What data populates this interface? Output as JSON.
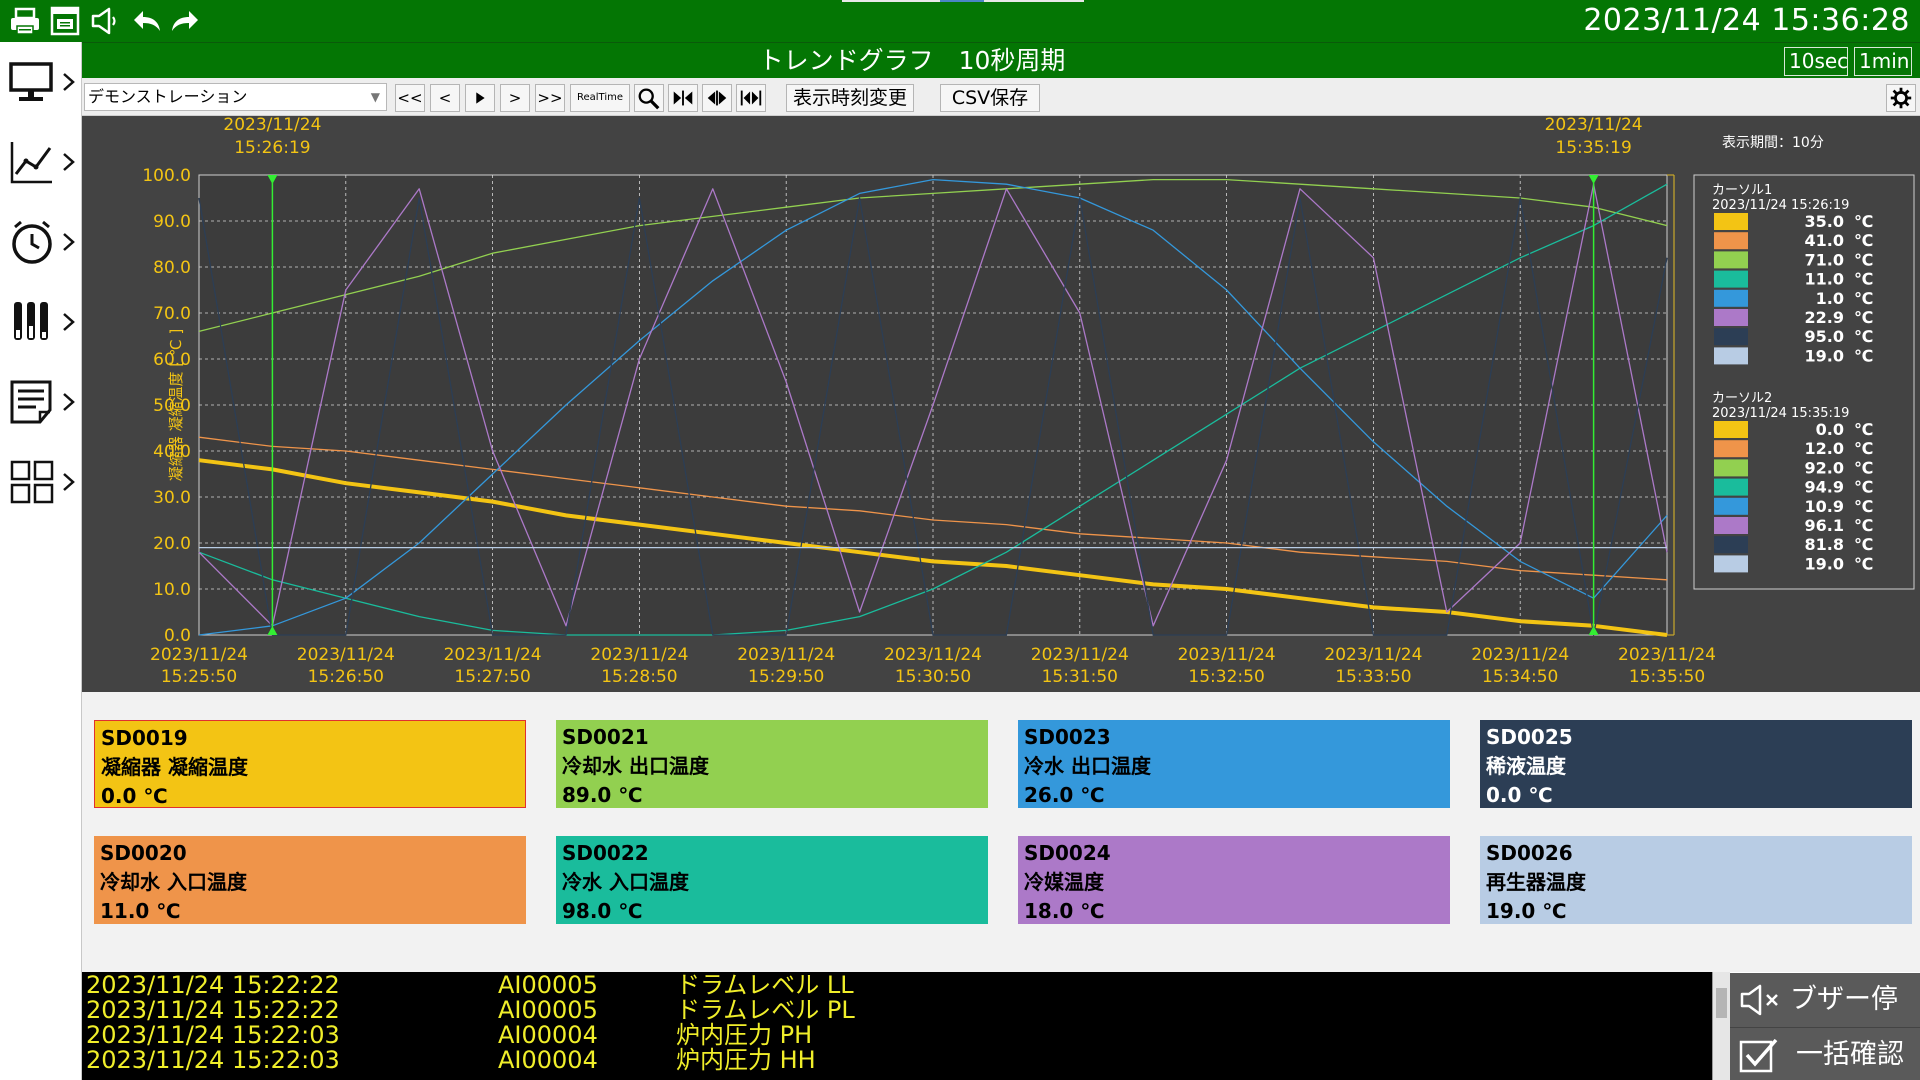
{
  "topbar": {
    "datetime": "2023/11/24 15:36:28",
    "icons": [
      "printer-icon",
      "printer-window-icon",
      "speaker-icon",
      "undo-icon",
      "redo-icon"
    ]
  },
  "sidebar": {
    "items": [
      "monitor-icon",
      "trend-chart-icon",
      "clock-icon",
      "bar-gauge-icon",
      "document-list-icon",
      "grid-tiles-icon"
    ]
  },
  "titlebar": {
    "title": "トレンドグラフ　10秒周期",
    "period_10sec": "10sec",
    "period_1min": "1min"
  },
  "toolbar": {
    "select_value": "デモンストレーション",
    "first": "<<",
    "prev": "<",
    "next": ">",
    "last": ">>",
    "realtime": "RealTime",
    "change_time": "表示時刻変更",
    "csv_save": "CSV保存"
  },
  "graph": {
    "ylabel": "凝縮器 凝縮温度 [ ℃ ]",
    "period_label": "表示期間：10分",
    "cursor1_top": [
      "2023/11/24",
      "15:26:19"
    ],
    "cursor2_top": [
      "2023/11/24",
      "15:35:19"
    ],
    "colors": [
      "#f3c414",
      "#ef944a",
      "#92d050",
      "#1abc9c",
      "#3498db",
      "#ac79c8",
      "#2c3e55",
      "#b8cce4"
    ]
  },
  "legend": {
    "cursor1": {
      "label": "カーソル1",
      "time": "2023/11/24 15:26:19",
      "values": [
        "35.0 ℃",
        "41.0 ℃",
        "71.0 ℃",
        "11.0 ℃",
        "1.0 ℃",
        "22.9 ℃",
        "95.0 ℃",
        "19.0 ℃"
      ]
    },
    "cursor2": {
      "label": "カーソル2",
      "time": "2023/11/24 15:35:19",
      "values": [
        "0.0 ℃",
        "12.0 ℃",
        "92.0 ℃",
        "94.9 ℃",
        "10.9 ℃",
        "96.1 ℃",
        "81.8 ℃",
        "19.0 ℃"
      ]
    }
  },
  "chart_data": {
    "type": "line",
    "ylabel": "凝縮器 凝縮温度 [ ℃ ]",
    "ylim": [
      0,
      100
    ],
    "y_ticks": [
      "100.0",
      "90.0",
      "80.0",
      "70.0",
      "60.0",
      "50.0",
      "40.0",
      "30.0",
      "20.0",
      "10.0",
      "0.0"
    ],
    "x_ticks": [
      [
        "2023/11/24",
        "15:25:50"
      ],
      [
        "2023/11/24",
        "15:26:50"
      ],
      [
        "2023/11/24",
        "15:27:50"
      ],
      [
        "2023/11/24",
        "15:28:50"
      ],
      [
        "2023/11/24",
        "15:29:50"
      ],
      [
        "2023/11/24",
        "15:30:50"
      ],
      [
        "2023/11/24",
        "15:31:50"
      ],
      [
        "2023/11/24",
        "15:32:50"
      ],
      [
        "2023/11/24",
        "15:33:50"
      ],
      [
        "2023/11/24",
        "15:34:50"
      ],
      [
        "2023/11/24",
        "15:35:50"
      ]
    ],
    "x_minutes": [
      0,
      0.5,
      1,
      1.5,
      2,
      2.5,
      3,
      3.5,
      4,
      4.5,
      5,
      5.5,
      6,
      6.5,
      7,
      7.5,
      8,
      8.5,
      9,
      9.5,
      10
    ],
    "series": [
      {
        "values": [
          38,
          36,
          33,
          31,
          29,
          26,
          24,
          22,
          20,
          18,
          16,
          15,
          13,
          11,
          10,
          8,
          6,
          5,
          3,
          2,
          0
        ]
      },
      {
        "values": [
          43,
          41,
          40,
          38,
          36,
          34,
          32,
          30,
          28,
          27,
          25,
          24,
          22,
          21,
          20,
          18,
          17,
          16,
          14,
          13,
          12
        ]
      },
      {
        "values": [
          66,
          70,
          74,
          78,
          83,
          86,
          89,
          91,
          93,
          95,
          96,
          97,
          98,
          99,
          99,
          98,
          97,
          96,
          95,
          93,
          89
        ]
      },
      {
        "values": [
          18,
          12,
          8,
          4,
          1,
          0,
          0,
          0,
          1,
          4,
          10,
          18,
          28,
          38,
          48,
          58,
          66,
          74,
          82,
          89,
          98
        ]
      },
      {
        "values": [
          0,
          2,
          8,
          20,
          35,
          50,
          64,
          77,
          88,
          96,
          99,
          98,
          95,
          88,
          75,
          58,
          42,
          28,
          16,
          8,
          26
        ]
      },
      {
        "values": [
          18,
          2,
          75,
          97,
          40,
          2,
          60,
          97,
          55,
          5,
          50,
          97,
          70,
          2,
          38,
          97,
          82,
          5,
          20,
          98,
          18
        ]
      },
      {
        "values": [
          95,
          0,
          0,
          95,
          0,
          0,
          95,
          0,
          0,
          95,
          0,
          0,
          95,
          0,
          0,
          95,
          0,
          0,
          95,
          0,
          82
        ]
      },
      {
        "values": [
          19,
          19,
          19,
          19,
          19,
          19,
          19,
          19,
          19,
          19,
          19,
          19,
          19,
          19,
          19,
          19,
          19,
          19,
          19,
          19,
          19
        ]
      }
    ]
  },
  "tiles": [
    {
      "code": "SD0019",
      "name": "凝縮器 凝縮温度",
      "value": "0.0 ℃"
    },
    {
      "code": "SD0021",
      "name": "冷却水 出口温度",
      "value": "89.0 ℃"
    },
    {
      "code": "SD0023",
      "name": "冷水 出口温度",
      "value": "26.0 ℃"
    },
    {
      "code": "SD0025",
      "name": "稀液温度",
      "value": "0.0 ℃"
    },
    {
      "code": "SD0020",
      "name": "冷却水 入口温度",
      "value": "11.0 ℃"
    },
    {
      "code": "SD0022",
      "name": "冷水 入口温度",
      "value": "98.0 ℃"
    },
    {
      "code": "SD0024",
      "name": "冷媒温度",
      "value": "18.0 ℃"
    },
    {
      "code": "SD0026",
      "name": "再生器温度",
      "value": "19.0 ℃"
    }
  ],
  "alarms": [
    {
      "time": "2023/11/24 15:22:22",
      "id": "AI00005",
      "text": "ドラムレベル LL"
    },
    {
      "time": "2023/11/24 15:22:22",
      "id": "AI00005",
      "text": "ドラムレベル PL"
    },
    {
      "time": "2023/11/24 15:22:03",
      "id": "AI00004",
      "text": "炉内圧力 PH"
    },
    {
      "time": "2023/11/24 15:22:03",
      "id": "AI00004",
      "text": "炉内圧力 HH"
    }
  ],
  "buttons": {
    "buzzer_stop": "ブザー停止",
    "bulk_confirm": "一括確認"
  }
}
